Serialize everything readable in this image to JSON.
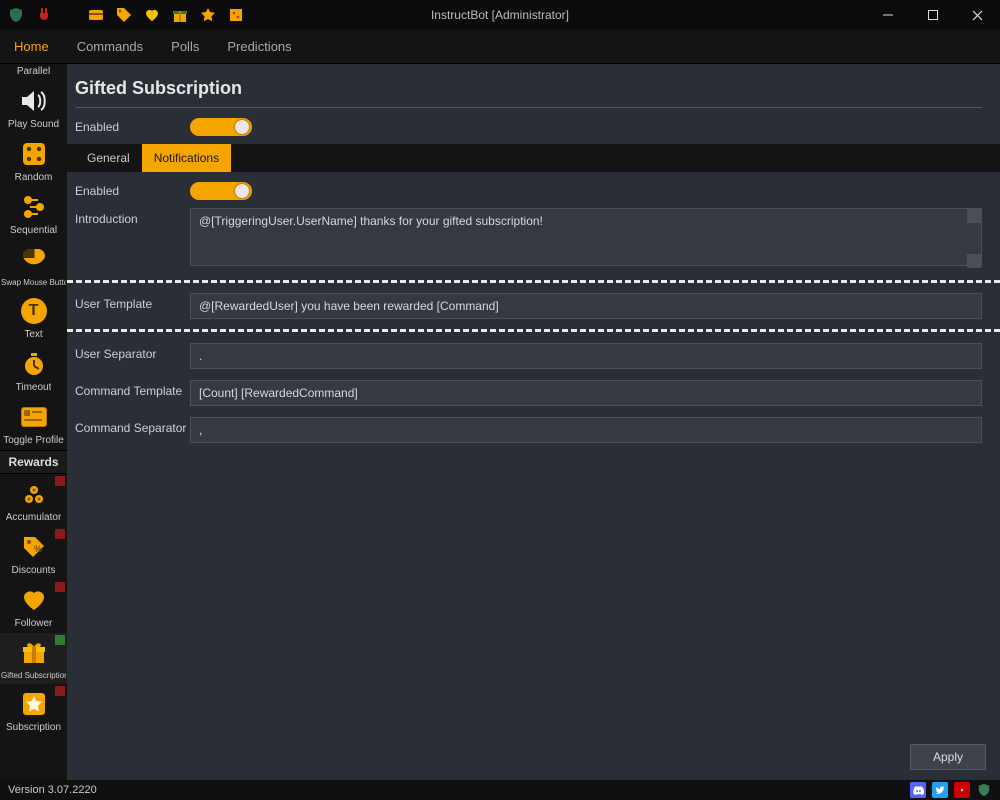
{
  "window": {
    "title": "InstructBot [Administrator]"
  },
  "nav": {
    "tabs": [
      "Home",
      "Commands",
      "Polls",
      "Predictions"
    ],
    "active": "Home"
  },
  "sidebar": {
    "groupHeader": "Rewards",
    "items_top": [
      {
        "label": "Parallel"
      },
      {
        "label": "Play Sound"
      },
      {
        "label": "Random"
      },
      {
        "label": "Sequential"
      },
      {
        "label": "Swap Mouse Button"
      },
      {
        "label": "Text"
      },
      {
        "label": "Timeout"
      },
      {
        "label": "Toggle Profile"
      }
    ],
    "items_rewards": [
      {
        "label": "Accumulator",
        "marker": "red"
      },
      {
        "label": "Discounts",
        "marker": "red"
      },
      {
        "label": "Follower",
        "marker": "red"
      },
      {
        "label": "Gifted Subscription",
        "marker": "green"
      },
      {
        "label": "Subscription",
        "marker": "red"
      }
    ]
  },
  "page": {
    "title": "Gifted Subscription",
    "enabled_label": "Enabled",
    "subtabs": [
      "General",
      "Notifications"
    ],
    "active_subtab": "Notifications",
    "notif_enabled_label": "Enabled",
    "fields": {
      "introduction": {
        "label": "Introduction",
        "value": "@[TriggeringUser.UserName] thanks for your gifted subscription!"
      },
      "user_template": {
        "label": "User Template",
        "value": "@[RewardedUser] you have been rewarded [Command]"
      },
      "user_separator": {
        "label": "User Separator",
        "value": "."
      },
      "command_template": {
        "label": "Command Template",
        "value": "[Count] [RewardedCommand]"
      },
      "command_separator": {
        "label": "Command Separator",
        "value": ","
      }
    },
    "apply_label": "Apply"
  },
  "status": {
    "version": "Version 3.07.2220"
  },
  "text_icon_letter": "T"
}
